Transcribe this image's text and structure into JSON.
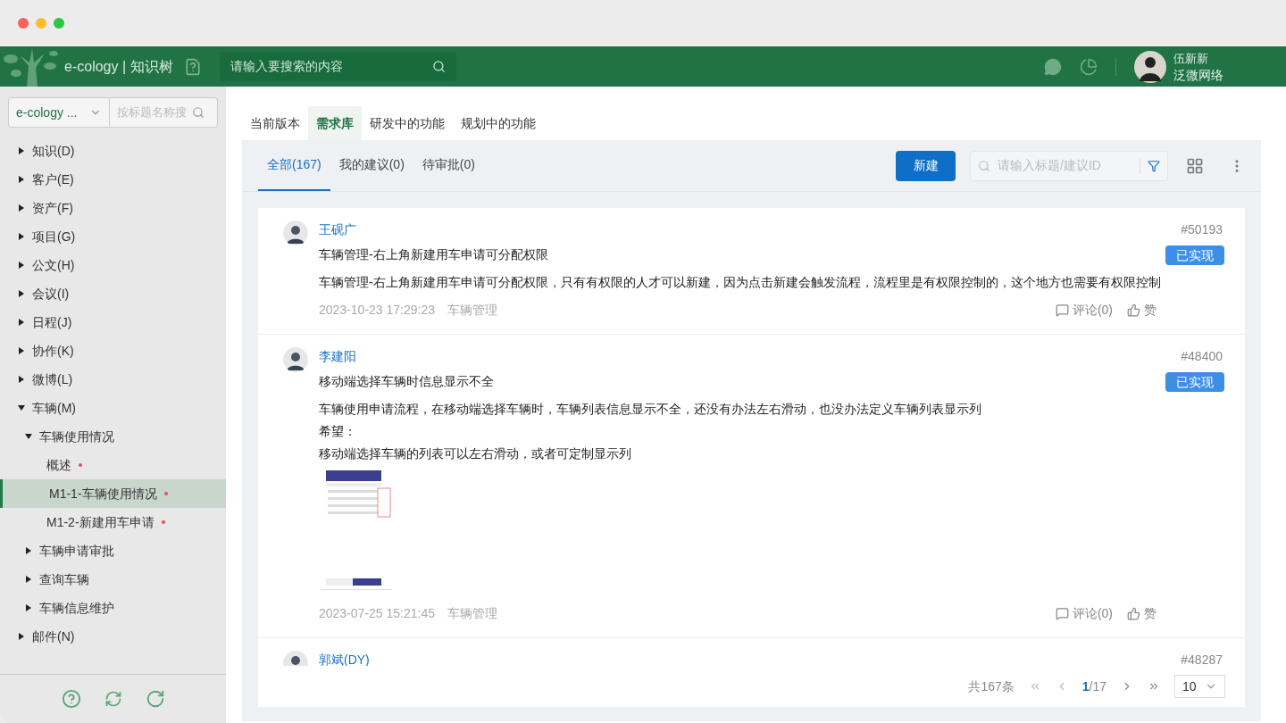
{
  "header": {
    "app_title": "e-cology | 知识树",
    "search_placeholder": "请输入要搜索的内容",
    "user_name": "伍新新",
    "user_org": "泛微网络"
  },
  "sidebar": {
    "select_value": "e-cology ...",
    "search_placeholder": "按标题名称搜",
    "tree": [
      {
        "label": "知识(D)",
        "expanded": false,
        "selected": false
      },
      {
        "label": "客户(E)",
        "expanded": false,
        "selected": false
      },
      {
        "label": "资产(F)",
        "expanded": false,
        "selected": false
      },
      {
        "label": "项目(G)",
        "expanded": false,
        "selected": false
      },
      {
        "label": "公文(H)",
        "expanded": false,
        "selected": false
      },
      {
        "label": "会议(I)",
        "expanded": false,
        "selected": false
      },
      {
        "label": "日程(J)",
        "expanded": false,
        "selected": false
      },
      {
        "label": "协作(K)",
        "expanded": false,
        "selected": false
      },
      {
        "label": "微博(L)",
        "expanded": false,
        "selected": false
      },
      {
        "label": "车辆(M)",
        "expanded": true,
        "selected": false,
        "children": [
          {
            "label": "车辆使用情况",
            "expanded": true,
            "selected": false,
            "children": [
              {
                "label": "概述",
                "selected": false,
                "dot": true
              },
              {
                "label": "M1-1-车辆使用情况",
                "selected": true,
                "dot": true
              },
              {
                "label": "M1-2-新建用车申请",
                "selected": false,
                "dot": true
              }
            ]
          },
          {
            "label": "车辆申请审批",
            "expanded": false,
            "selected": false
          },
          {
            "label": "查询车辆",
            "expanded": false,
            "selected": false
          },
          {
            "label": "车辆信息维护",
            "expanded": false,
            "selected": false
          }
        ]
      },
      {
        "label": "邮件(N)",
        "expanded": false,
        "selected": false
      }
    ]
  },
  "tabs": [
    {
      "label": "当前版本",
      "selected": false
    },
    {
      "label": "需求库",
      "selected": true
    },
    {
      "label": "研发中的功能",
      "selected": false
    },
    {
      "label": "规划中的功能",
      "selected": false
    }
  ],
  "subtabs": [
    {
      "label": "全部(167)",
      "selected": true
    },
    {
      "label": "我的建议(0)",
      "selected": false
    },
    {
      "label": "待审批(0)",
      "selected": false
    }
  ],
  "new_button": "新建",
  "filter_placeholder": "请输入标题/建议ID",
  "posts": [
    {
      "author": "王砚广",
      "id": "#50193",
      "status": "已实现",
      "title": "车辆管理-右上角新建用车申请可分配权限",
      "body": [
        "车辆管理-右上角新建用车申请可分配权限，只有有权限的人才可以新建，因为点击新建会触发流程，流程里是有权限控制的，这个地方也需要有权限控制"
      ],
      "time": "2023-10-23 17:29:23",
      "category": "车辆管理",
      "comments": "评论(0)",
      "like": "赞"
    },
    {
      "author": "李建阳",
      "id": "#48400",
      "status": "已实现",
      "title": "移动端选择车辆时信息显示不全",
      "body": [
        "车辆使用申请流程，在移动端选择车辆时，车辆列表信息显示不全，还没有办法左右滑动，也没办法定义车辆列表显示列",
        "希望：",
        "移动端选择车辆的列表可以左右滑动，或者可定制显示列"
      ],
      "has_image": true,
      "time": "2023-07-25 15:21:45",
      "category": "车辆管理",
      "comments": "评论(0)",
      "like": "赞"
    },
    {
      "author": "郭斌(DY)",
      "id": "#48287"
    }
  ],
  "pagination": {
    "total": "共167条",
    "current": "1",
    "pages": "/17",
    "page_size": "10"
  }
}
